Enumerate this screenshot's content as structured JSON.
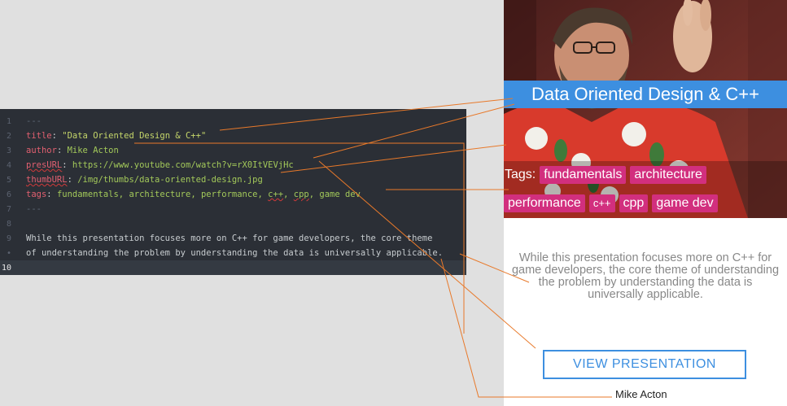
{
  "editor": {
    "lines": [
      {
        "num": "1",
        "parts": [
          [
            "c",
            "---"
          ]
        ]
      },
      {
        "num": "2",
        "parts": [
          [
            "k",
            "title"
          ],
          [
            "t",
            ": "
          ],
          [
            "s",
            "\"Data Oriented Design & C++\""
          ]
        ]
      },
      {
        "num": "3",
        "parts": [
          [
            "k",
            "author"
          ],
          [
            "t",
            ": "
          ],
          [
            "v",
            "Mike Acton"
          ]
        ]
      },
      {
        "num": "4",
        "parts": [
          [
            "k",
            "presURL"
          ],
          [
            "t",
            ": "
          ],
          [
            "v",
            "https://www.youtube.com/watch?v=rX0ItVEVjHc"
          ]
        ]
      },
      {
        "num": "5",
        "parts": [
          [
            "k",
            "thumbURL"
          ],
          [
            "t",
            ": "
          ],
          [
            "v",
            "/img/thumbs/data-oriented-design.jpg"
          ]
        ]
      },
      {
        "num": "6",
        "parts": [
          [
            "k",
            "tags"
          ],
          [
            "t",
            ": "
          ],
          [
            "v",
            "fundamentals, architecture, performance, "
          ],
          [
            "vs",
            "c++"
          ],
          [
            "v",
            ", "
          ],
          [
            "vs",
            "cpp"
          ],
          [
            "v",
            ", game dev"
          ]
        ]
      },
      {
        "num": "7",
        "parts": [
          [
            "c",
            "---"
          ]
        ]
      },
      {
        "num": "8",
        "parts": []
      },
      {
        "num": "9",
        "parts": [
          [
            "t",
            "While this presentation focuses more on C++ for game developers, the core theme"
          ]
        ]
      },
      {
        "num": "•",
        "parts": [
          [
            "t",
            "of understanding the problem by understanding the data is universally applicable."
          ]
        ]
      },
      {
        "num": "10",
        "parts": [],
        "active": true
      }
    ]
  },
  "card": {
    "title": "Data Oriented Design & C++",
    "tags_label": "Tags:",
    "tags_row1": [
      "fundamentals",
      "architecture"
    ],
    "tags_row2": [
      "performance",
      "c++",
      "cpp",
      "game dev"
    ],
    "description": "While this presentation focuses more on C++ for game developers, the core theme of understanding the problem by understanding the data is universally applicable.",
    "button_label": "VIEW PRESENTATION"
  },
  "author_output": "Mike Acton",
  "colors": {
    "accent_blue": "#3d8fe0",
    "tag_pink": "#d22f7e",
    "connector_orange": "#e8792a",
    "editor_bg": "#2b2f36"
  }
}
